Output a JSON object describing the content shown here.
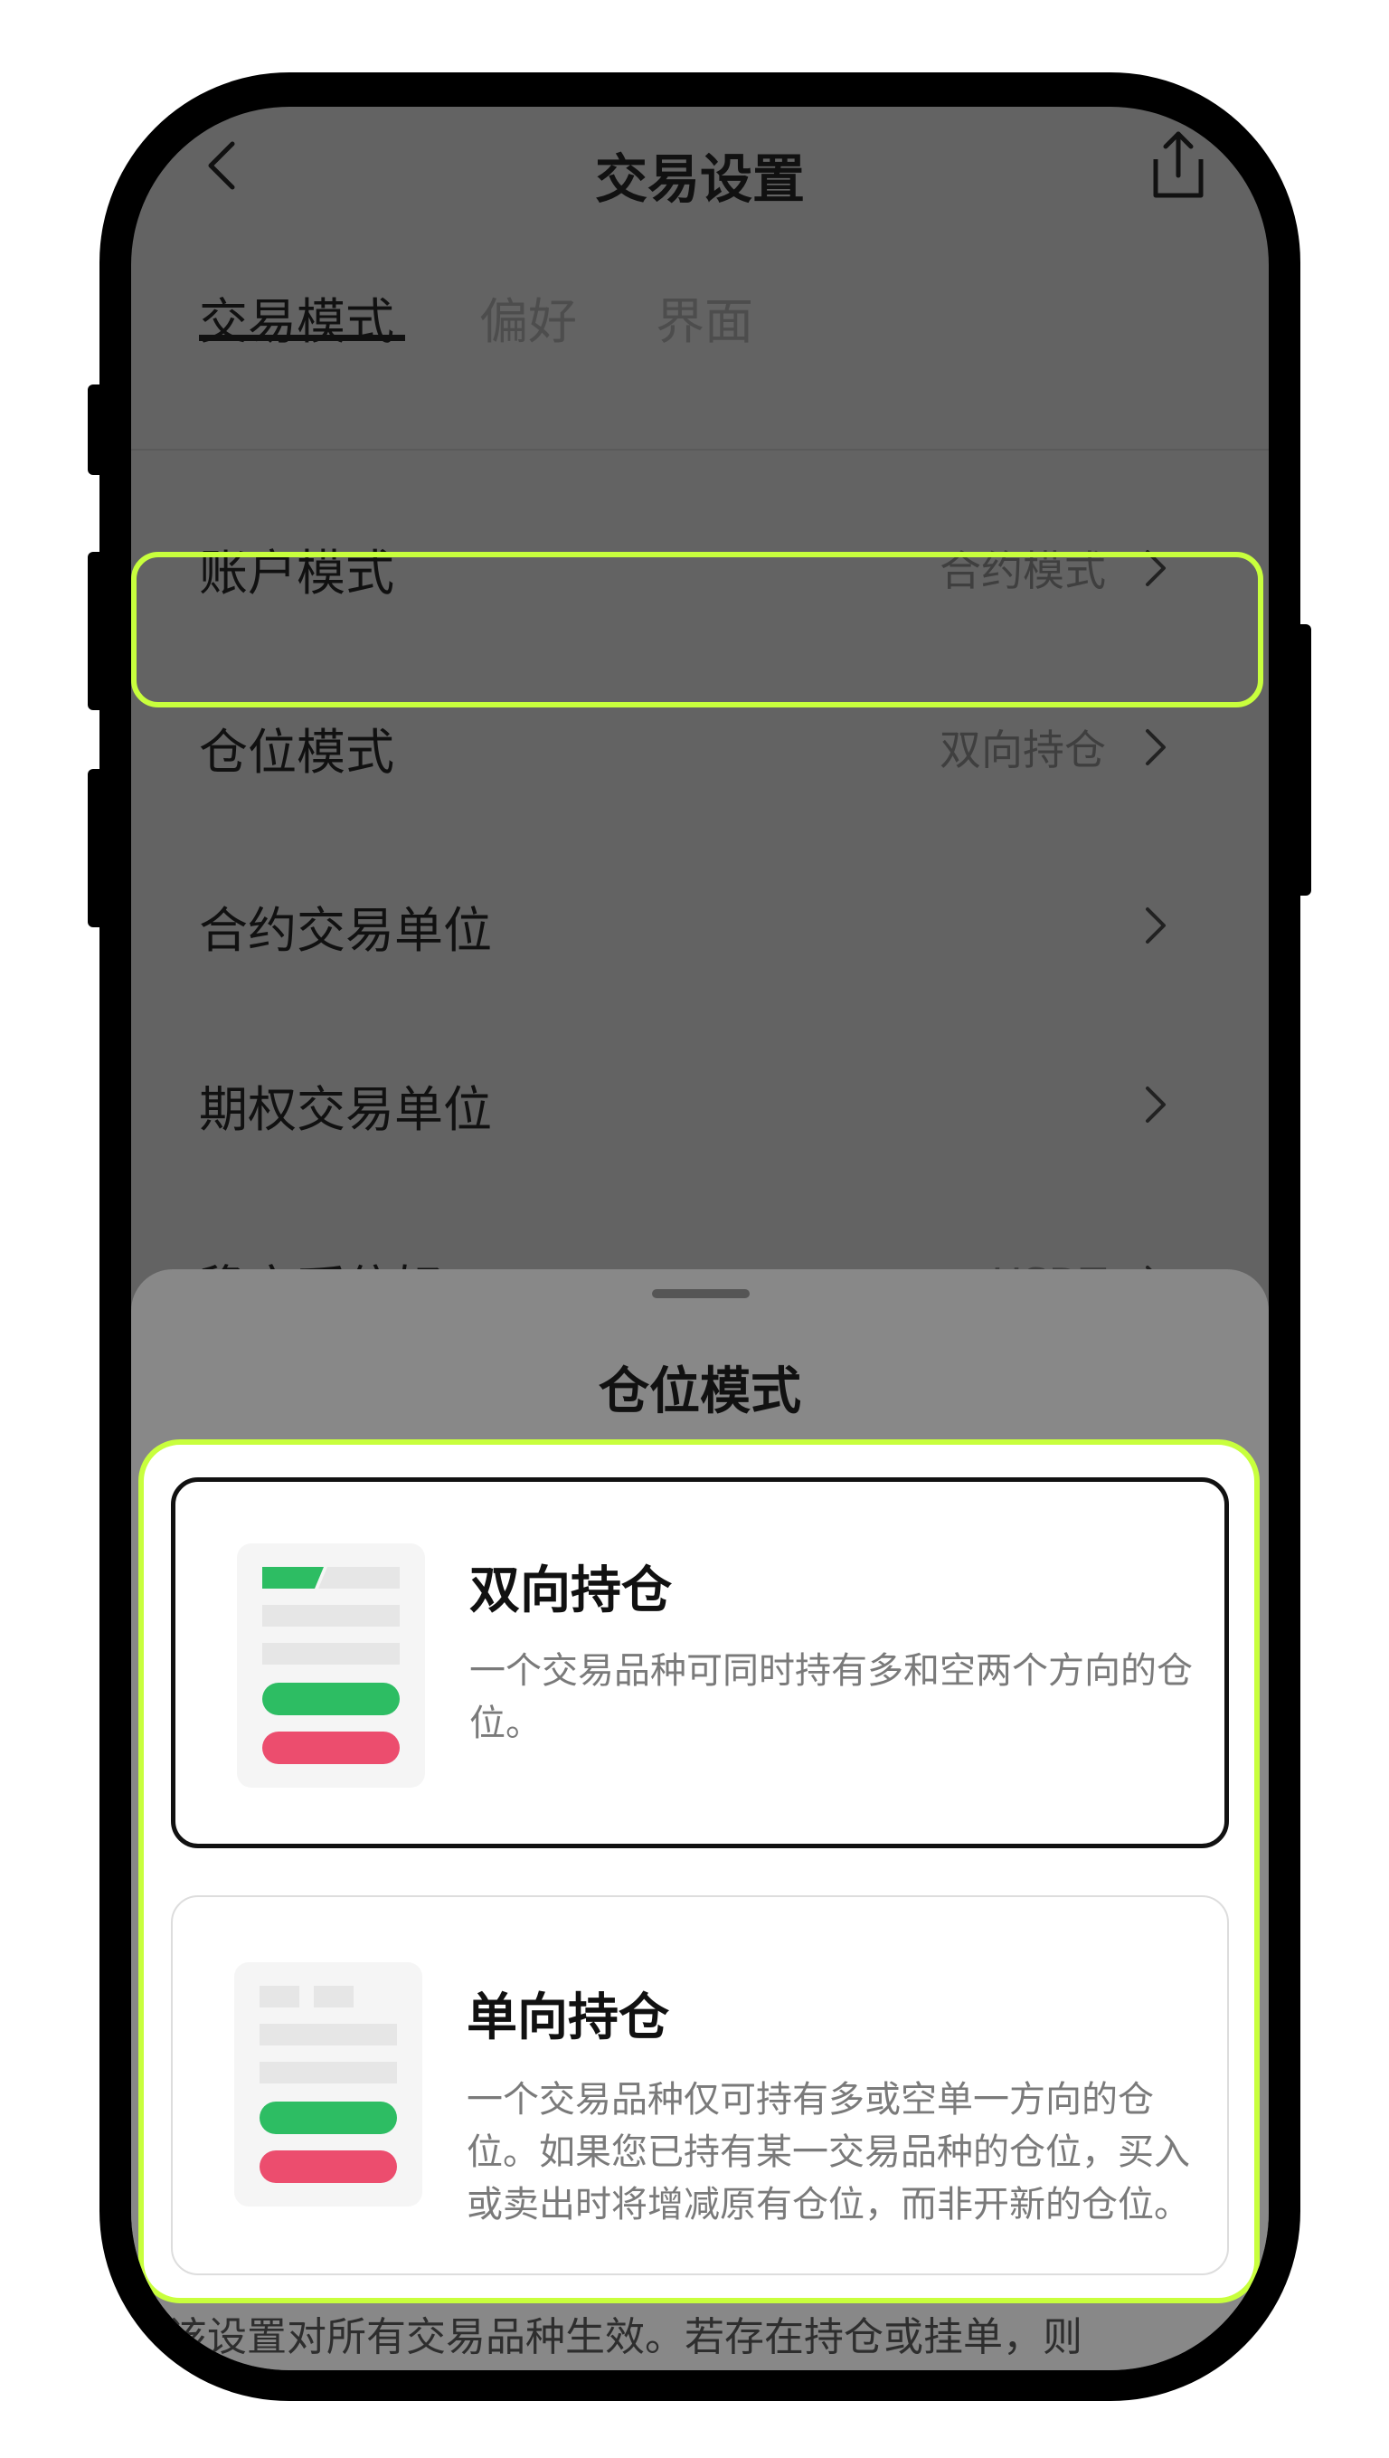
{
  "header": {
    "title": "交易设置",
    "back_icon": "chevron-left-icon",
    "share_icon": "share-icon"
  },
  "tabs": [
    {
      "label": "交易模式",
      "active": true
    },
    {
      "label": "偏好",
      "active": false
    },
    {
      "label": "界面",
      "active": false
    }
  ],
  "settings": [
    {
      "label": "账户模式",
      "value": "合约模式"
    },
    {
      "label": "仓位模式",
      "value": "双向持仓"
    },
    {
      "label": "合约交易单位",
      "value": ""
    },
    {
      "label": "期权交易单位",
      "value": ""
    },
    {
      "label": "稳定币偏好",
      "value": "USDT"
    }
  ],
  "sheet": {
    "title": "仓位模式",
    "options": [
      {
        "title": "双向持仓",
        "desc": "一个交易品种可同时持有多和空两个方向的仓位。",
        "selected": true
      },
      {
        "title": "单向持仓",
        "desc": "一个交易品种仅可持有多或空单一方向的仓位。如果您已持有某一交易品种的仓位，买入或卖出时将增减原有仓位，而非开新的仓位。",
        "selected": false
      }
    ],
    "footer_note": "该设置对所有交易品种生效。若存在持仓或挂单，则"
  },
  "colors": {
    "highlight": "#c8ff3d",
    "green": "#2dbd63",
    "red": "#ec4d6e",
    "overlay": "#636363"
  }
}
